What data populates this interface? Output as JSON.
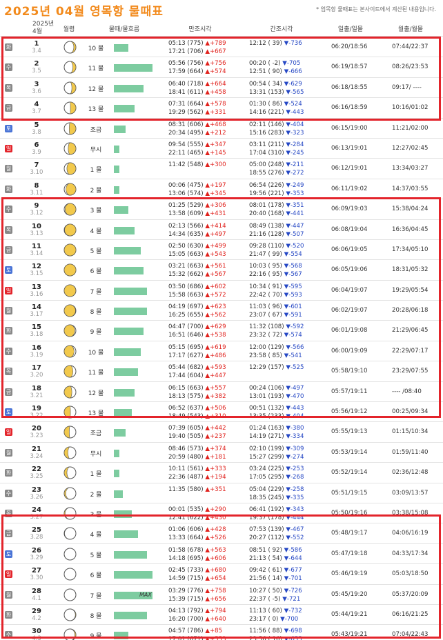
{
  "page": {
    "title": "2025년 04월 영목항 물때표",
    "note": "* 업목항 물때표는 본사이트에서 계산된 내용입니다."
  },
  "columns": {
    "date_year": "2025년",
    "date_month": "4월",
    "moon": "월령",
    "tide": "물때/물흐름",
    "high": "만조시각",
    "low": "간조시각",
    "sun": "일출/일몰",
    "moonrs": "월출/월몰"
  },
  "colors": {
    "sat": "#4a74d6",
    "sun": "#e3242b",
    "weekday": "#888888",
    "accent": "#f28a1c",
    "bar": "#7dcca0",
    "highlight_box": "#e3242b"
  },
  "rows": [
    {
      "d": "1",
      "wd": "화",
      "lunar": "3.4",
      "phase": 0.14,
      "mul": "10 물",
      "bar": 0.38,
      "h1": "05:13 (775)",
      "hd1": "+789",
      "h2": "17:21 (706)",
      "hd2": "+667",
      "l1": "12:12 ( 39)",
      "ld1": "-736",
      "l2": "",
      "ld2": "",
      "sun": "06:20/18:56",
      "moon": "07:44/22:37",
      "type": "weekday"
    },
    {
      "d": "2",
      "wd": "수",
      "lunar": "3.5",
      "phase": 0.17,
      "mul": "11 물",
      "bar": 1.0,
      "h1": "05:56 (756)",
      "hd1": "+756",
      "h2": "17:59 (664)",
      "hd2": "+574",
      "l1": "00:20 ( -2)",
      "ld1": "-705",
      "l2": "12:51 ( 90)",
      "ld2": "-666",
      "sun": "06:19/18:57",
      "moon": "08:26/23:53",
      "type": "weekday"
    },
    {
      "d": "3",
      "wd": "목",
      "lunar": "3.6",
      "phase": 0.2,
      "mul": "12 물",
      "bar": 0.77,
      "h1": "06:40 (718)",
      "hd1": "+664",
      "h2": "18:41 (611)",
      "hd2": "+458",
      "l1": "00:54 ( 34)",
      "ld1": "-629",
      "l2": "13:31 (153)",
      "ld2": "-565",
      "sun": "06:18/18:55",
      "moon": "09:17/ ----",
      "type": "weekday"
    },
    {
      "d": "4",
      "wd": "금",
      "lunar": "3.7",
      "phase": 0.24,
      "mul": "13 물",
      "bar": 0.54,
      "h1": "07:31 (664)",
      "hd1": "+578",
      "h2": "19:29 (562)",
      "hd2": "+331",
      "l1": "01:30 ( 86)",
      "ld1": "-524",
      "l2": "14:16 (221)",
      "ld2": "-443",
      "sun": "06:16/18:59",
      "moon": "10:16/01:02",
      "type": "weekday"
    },
    {
      "d": "5",
      "wd": "토",
      "lunar": "3.8",
      "phase": 0.27,
      "mul": "조금",
      "bar": 0.31,
      "h1": "08:31 (606)",
      "hd1": "+468",
      "h2": "20:34 (495)",
      "hd2": "+212",
      "l1": "02:11 (146)",
      "ld1": "-404",
      "l2": "15:16 (283)",
      "ld2": "-323",
      "sun": "06:15/19:00",
      "moon": "11:21/02:00",
      "type": "sat"
    },
    {
      "d": "6",
      "wd": "일",
      "lunar": "3.9",
      "phase": 0.3,
      "mul": "무시",
      "bar": 0.15,
      "h1": "09:54 (555)",
      "hd1": "+347",
      "h2": "22:11 (465)",
      "hd2": "+145",
      "l1": "03:11 (211)",
      "ld1": "-284",
      "l2": "17:04 (310)",
      "ld2": "-245",
      "sun": "06:13/19:01",
      "moon": "12:27/02:45",
      "type": "sun"
    },
    {
      "d": "7",
      "wd": "월",
      "lunar": "3.10",
      "phase": 0.34,
      "mul": "1 물",
      "bar": 0.15,
      "h1": "11:42 (548)",
      "hd1": "+300",
      "h2": "",
      "hd2": "",
      "l1": "05:00 (248)",
      "ld1": "-211",
      "l2": "18:55 (276)",
      "ld2": "-272",
      "sun": "06:12/19:01",
      "moon": "13:34/03:27",
      "type": "weekday"
    },
    {
      "d": "8",
      "wd": "화",
      "lunar": "3.11",
      "phase": 0.37,
      "mul": "2 물",
      "bar": 0.15,
      "h1": "00:06 (475)",
      "hd1": "+197",
      "h2": "13:06 (574)",
      "hd2": "+345",
      "l1": "06:54 (226)",
      "ld1": "-249",
      "l2": "19:56 (221)",
      "ld2": "-353",
      "sun": "06:11/19:02",
      "moon": "14:37/03:55",
      "type": "weekday"
    },
    {
      "d": "9",
      "wd": "수",
      "lunar": "3.12",
      "phase": 0.41,
      "mul": "3 물",
      "bar": 0.38,
      "h1": "01:25 (529)",
      "hd1": "+306",
      "h2": "13:58 (609)",
      "hd2": "+431",
      "l1": "08:01 (178)",
      "ld1": "-351",
      "l2": "20:40 (168)",
      "ld2": "-441",
      "sun": "06:09/19:03",
      "moon": "15:38/04:24",
      "type": "weekday"
    },
    {
      "d": "10",
      "wd": "목",
      "lunar": "3.13",
      "phase": 0.44,
      "mul": "4 물",
      "bar": 0.54,
      "h1": "02:13 (566)",
      "hd1": "+414",
      "h2": "14:34 (635)",
      "hd2": "+497",
      "l1": "08:49 (138)",
      "ld1": "-447",
      "l2": "21:16 (128)",
      "ld2": "-507",
      "sun": "06:08/19:04",
      "moon": "16:36/04:45",
      "type": "weekday"
    },
    {
      "d": "11",
      "wd": "금",
      "lunar": "3.14",
      "phase": 0.48,
      "mul": "5 물",
      "bar": 0.69,
      "h1": "02:50 (630)",
      "hd1": "+499",
      "h2": "15:05 (663)",
      "hd2": "+543",
      "l1": "09:28 (110)",
      "ld1": "-520",
      "l2": "21:47 ( 99)",
      "ld2": "-554",
      "sun": "06:06/19:05",
      "moon": "17:34/05:10",
      "type": "weekday"
    },
    {
      "d": "12",
      "wd": "토",
      "lunar": "3.15",
      "phase": 0.5,
      "mul": "6 물",
      "bar": 0.77,
      "h1": "03:21 (663)",
      "hd1": "+561",
      "h2": "15:32 (662)",
      "hd2": "+567",
      "l1": "10:03 ( 95)",
      "ld1": "-568",
      "l2": "22:16 ( 95)",
      "ld2": "-567",
      "sun": "06:05/19:06",
      "moon": "18:31/05:32",
      "type": "sat"
    },
    {
      "d": "13",
      "wd": "일",
      "lunar": "3.16",
      "phase": 0.53,
      "mul": "7 물",
      "bar": 0.85,
      "h1": "03:50 (686)",
      "hd1": "+602",
      "h2": "15:58 (663)",
      "hd2": "+572",
      "l1": "10:34 ( 91)",
      "ld1": "-595",
      "l2": "22:42 ( 70)",
      "ld2": "-593",
      "sun": "06:04/19:07",
      "moon": "19:29/05:54",
      "type": "sun"
    },
    {
      "d": "14",
      "wd": "월",
      "lunar": "3.17",
      "phase": 0.56,
      "mul": "8 물",
      "bar": 0.85,
      "h1": "04:19 (697)",
      "hd1": "+623",
      "h2": "16:25 (655)",
      "hd2": "+562",
      "l1": "11:03 ( 96)",
      "ld1": "-601",
      "l2": "23:07 ( 67)",
      "ld2": "-591",
      "sun": "06:02/19:07",
      "moon": "20:28/06:18",
      "type": "weekday"
    },
    {
      "d": "15",
      "wd": "화",
      "lunar": "3.18",
      "phase": 0.6,
      "mul": "9 물",
      "bar": 0.77,
      "h1": "04:47 (700)",
      "hd1": "+629",
      "h2": "16:51 (646)",
      "hd2": "+538",
      "l1": "11:32 (108)",
      "ld1": "-592",
      "l2": "23:32 ( 72)",
      "ld2": "-574",
      "sun": "06:01/19:08",
      "moon": "21:29/06:45",
      "type": "weekday"
    },
    {
      "d": "16",
      "wd": "수",
      "lunar": "3.19",
      "phase": 0.63,
      "mul": "10 물",
      "bar": 0.69,
      "h1": "05:15 (695)",
      "hd1": "+619",
      "h2": "17:17 (627)",
      "hd2": "+486",
      "l1": "12:00 (129)",
      "ld1": "-566",
      "l2": "23:58 ( 85)",
      "ld2": "-541",
      "sun": "06:00/19:09",
      "moon": "22:29/07:17",
      "type": "weekday"
    },
    {
      "d": "17",
      "wd": "목",
      "lunar": "3.20",
      "phase": 0.67,
      "mul": "11 물",
      "bar": 0.62,
      "h1": "05:44 (682)",
      "hd1": "+593",
      "h2": "17:44 (604)",
      "hd2": "+447",
      "l1": "12:29 (157)",
      "ld1": "-525",
      "l2": "",
      "ld2": "",
      "sun": "05:58/19:10",
      "moon": "23:29/07:55",
      "type": "weekday"
    },
    {
      "d": "18",
      "wd": "금",
      "lunar": "3.21",
      "phase": 0.7,
      "mul": "12 물",
      "bar": 0.54,
      "h1": "06:15 (663)",
      "hd1": "+557",
      "h2": "18:13 (575)",
      "hd2": "+382",
      "l1": "00:24 (106)",
      "ld1": "-497",
      "l2": "13:01 (193)",
      "ld2": "-470",
      "sun": "05:57/19:11",
      "moon": "---- /08:40",
      "type": "weekday"
    },
    {
      "d": "19",
      "wd": "토",
      "lunar": "3.22",
      "phase": 0.74,
      "mul": "13 물",
      "bar": 0.46,
      "h1": "06:52 (637)",
      "hd1": "+506",
      "h2": "18:49 (543)",
      "hd2": "+310",
      "l1": "00:51 (132)",
      "ld1": "-443",
      "l2": "13:35 (233)",
      "ld2": "-404",
      "sun": "05:56/19:12",
      "moon": "00:25/09:34",
      "type": "sat"
    },
    {
      "d": "20",
      "wd": "일",
      "lunar": "3.23",
      "phase": 0.77,
      "mul": "조금",
      "bar": 0.31,
      "h1": "07:39 (605)",
      "hd1": "+442",
      "h2": "19:40 (505)",
      "hd2": "+237",
      "l1": "01:24 (163)",
      "ld1": "-380",
      "l2": "14:19 (271)",
      "ld2": "-334",
      "sun": "05:55/19:13",
      "moon": "01:15/10:34",
      "type": "sun"
    },
    {
      "d": "21",
      "wd": "월",
      "lunar": "3.24",
      "phase": 0.81,
      "mul": "무시",
      "bar": 0.15,
      "h1": "08:46 (573)",
      "hd1": "+374",
      "h2": "20:59 (480)",
      "hd2": "+181",
      "l1": "02:10 (199)",
      "ld1": "-309",
      "l2": "15:27 (299)",
      "ld2": "-274",
      "sun": "05:53/19:14",
      "moon": "01:59/11:40",
      "type": "weekday"
    },
    {
      "d": "22",
      "wd": "화",
      "lunar": "3.25",
      "phase": 0.84,
      "mul": "1 물",
      "bar": 0.15,
      "h1": "10:11 (561)",
      "hd1": "+333",
      "h2": "22:36 (487)",
      "hd2": "+194",
      "l1": "03:24 (225)",
      "ld1": "-253",
      "l2": "17:05 (295)",
      "ld2": "-268",
      "sun": "05:52/19:14",
      "moon": "02:36/12:48",
      "type": "weekday"
    },
    {
      "d": "23",
      "wd": "수",
      "lunar": "3.26",
      "phase": 0.88,
      "mul": "2 물",
      "bar": 0.23,
      "h1": "11:35 (580)",
      "hd1": "+351",
      "h2": "",
      "hd2": "",
      "l1": "05:04 (229)",
      "ld1": "-258",
      "l2": "18:35 (245)",
      "ld2": "-335",
      "sun": "05:51/19:15",
      "moon": "03:09/13:57",
      "type": "weekday"
    },
    {
      "d": "24",
      "wd": "목",
      "lunar": "3.27",
      "phase": 0.91,
      "mul": "3 물",
      "bar": 0.46,
      "h1": "00:01 (535)",
      "hd1": "+290",
      "h2": "12:41 (622)",
      "hd2": "+430",
      "l1": "06:41 (192)",
      "ld1": "-343",
      "l2": "19:37 (178)",
      "ld2": "-444",
      "sun": "05:50/19:16",
      "moon": "03:38/15:08",
      "type": "weekday"
    },
    {
      "d": "25",
      "wd": "금",
      "lunar": "3.28",
      "phase": 0.94,
      "mul": "4 물",
      "bar": 0.62,
      "h1": "01:06 (606)",
      "hd1": "+428",
      "h2": "13:33 (664)",
      "hd2": "+526",
      "l1": "07:53 (139)",
      "ld1": "-467",
      "l2": "20:27 (112)",
      "ld2": "-552",
      "sun": "05:48/19:17",
      "moon": "04:06/16:19",
      "type": "weekday"
    },
    {
      "d": "26",
      "wd": "토",
      "lunar": "3.29",
      "phase": 0.97,
      "mul": "5 물",
      "bar": 0.85,
      "h1": "01:58 (678)",
      "hd1": "+563",
      "h2": "14:18 (695)",
      "hd2": "+606",
      "l1": "08:51 ( 92)",
      "ld1": "-586",
      "l2": "21:13 ( 54)",
      "ld2": "-644",
      "sun": "05:47/19:18",
      "moon": "04:33/17:34",
      "type": "sat"
    },
    {
      "d": "27",
      "wd": "일",
      "lunar": "3.30",
      "phase": 0.0,
      "mul": "6 물",
      "bar": 1.0,
      "h1": "02:45 (733)",
      "hd1": "+680",
      "h2": "14:59 (715)",
      "hd2": "+654",
      "l1": "09:42 ( 61)",
      "ld1": "-677",
      "l2": "21:56 ( 14)",
      "ld2": "-701",
      "sun": "05:46/19:19",
      "moon": "05:03/18:50",
      "type": "sun"
    },
    {
      "d": "28",
      "wd": "월",
      "lunar": "4.1",
      "phase": 0.03,
      "mul": "7 물",
      "bar": 1.0,
      "max": "MAX",
      "h1": "03:29 (776)",
      "hd1": "+758",
      "h2": "15:39 (715)",
      "hd2": "+656",
      "l1": "10:27 ( 50)",
      "ld1": "-726",
      "l2": "22:37 ( -5)",
      "ld2": "-721",
      "sun": "05:45/19:20",
      "moon": "05:37/20:09",
      "type": "weekday"
    },
    {
      "d": "29",
      "wd": "화",
      "lunar": "4.2",
      "phase": 0.07,
      "mul": "8 물",
      "bar": 0.85,
      "h1": "04:13 (792)",
      "hd1": "+794",
      "h2": "16:20 (700)",
      "hd2": "+640",
      "l1": "11:13 ( 60)",
      "ld1": "-732",
      "l2": "23:17 ( 0)",
      "ld2": "-700",
      "sun": "05:44/19:21",
      "moon": "06:16/21:25",
      "type": "weekday"
    },
    {
      "d": "30",
      "wd": "수",
      "lunar": "4.3",
      "phase": 0.1,
      "mul": "9 물",
      "bar": 0.38,
      "h1": "04:57 (786)",
      "hd1": "+85",
      "h2": "17:01 (671)",
      "hd2": "+553",
      "l1": "11:56 ( 88)",
      "ld1": "-698",
      "l2": "23:56 ( 16)",
      "ld2": "-655",
      "sun": "05:43/19:21",
      "moon": "07:04/22:43",
      "type": "weekday"
    }
  ]
}
